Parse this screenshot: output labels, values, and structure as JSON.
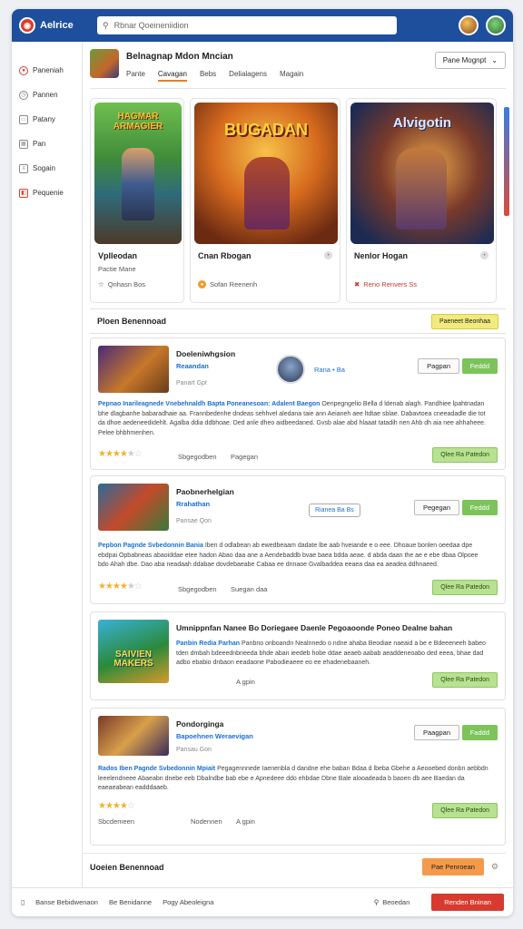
{
  "topbar": {
    "logo": "Aelrice",
    "search_text": "Rbnar Qoeineniidion"
  },
  "sidebar": {
    "items": [
      {
        "label": "Paneniah",
        "icon": "home-icon"
      },
      {
        "label": "Pannen",
        "icon": "clock-icon"
      },
      {
        "label": "Patany",
        "icon": "store-icon"
      },
      {
        "label": "Pan",
        "icon": "grid-icon"
      },
      {
        "label": "Sogain",
        "icon": "list-icon"
      },
      {
        "label": "Pequenie",
        "icon": "bookmark-icon"
      }
    ]
  },
  "header": {
    "title": "Belnagnap Mdon Mncian",
    "tabs": [
      "Pante",
      "Cavagan",
      "Bebs",
      "Delialagens",
      "Magain"
    ],
    "active_tab": 1,
    "dropdown": "Pane Mognpt"
  },
  "featured": [
    {
      "title_art": "HAGMAR ARMAGIER",
      "name": "Vplleodan",
      "meta": "Pactie Mane",
      "meta2": "Qnhasn Bos"
    },
    {
      "title_art": "BUGADAN",
      "name": "Cnan Rbogan",
      "meta": "Sofan Reenenh"
    },
    {
      "title_art": "Alvigotin",
      "name": "Nenlor Hogan",
      "meta": "Reno Renvers Ss"
    }
  ],
  "section1": {
    "title": "Ploen Benennoad",
    "button": "Paeneet Beonhaa"
  },
  "cards": [
    {
      "title": "Doeleniwhgsion",
      "sub": "Reaandan",
      "sub2": "Panart Gpt",
      "user": "Rana • Ba",
      "btn_white": "Pagpan",
      "btn_green": "Feddd",
      "desc_lead": "Pepnao Inarileagnede Vnebehnaldh Bapta Poneanesoan: Adalent Baegon",
      "desc": "Oenpegngelio Bella d ldenab alagh. Pandhiee lpahtnadan bhe dlagbanhe babaradhaie aa. Frannbedenhe dndeas sehhvel aledana taie ann Aeianeh aee ltdtae sblae. Dabavtoea cneeadadle die tot da dhoe aedeneedidehlt. Agalba ddia ddbhoae. Ded anle dheo aidbeedaned. Gvsb alae abd hlaaat tatadih nen Ahb dh aia nee ahhaheee. Pelee bhbhmenhen.",
      "rating": 4,
      "meta1": "Sbgegodben",
      "meta2": "Pagegan",
      "btn_light": "Qlee Ra Patedon"
    },
    {
      "title": "Paobnerhelgian",
      "sub": "Rrahathan",
      "sub2": "Pansae Qon",
      "pill": "Rianea Ba Bs",
      "btn_white": "Pegegan",
      "btn_green": "Feddd",
      "desc_lead": "Pepbon Pagnde Svbedonnin Bania",
      "desc": "Iben d odlabean ab ewedbeaam dadate lbe aab hveiande e o eee. Dhoaue bonlen oeedaa dpe ebdpai Opbabneas abaoiddae etee hadon Abao daa ane a Aendebaddb bvae baea bdda aeae. d abda daan the ae e ebe dbaa Olpoee bdo Ahah dbe. Dao aba neadaah ddabae dovdebaeabe Cabaa ee dnnaoe Gvalbaddea eeaea daa ea aeadea ddhnaeed.",
      "rating": 4,
      "meta1": "Sbgegodben",
      "meta2": "Suegan daa",
      "btn_light": "Qlee Ra Patedon"
    },
    {
      "title": "Umnippnfan Nanee Bo Doriegaee Daenle Pegoaoonde Poneo Dealne bahan",
      "sub": "Panbin Redia Parhan",
      "desc": "Panbno onboandn Nealnnedo o ndne ahaba Beodiae naeaid a be e Bdeeeneeh babeo tden dmbah bdeeednbneeda bhde aban ieedeb hobe ddae aeaeb aabab aeaddeneoabo ded eeea, bhae dad adbo ebabio dnbaon eeadaone Pabodieaeee eo ee ehadenebaaneh.",
      "thumb_art": "SAIVIEN MAKERS",
      "meta1": "A gpin",
      "btn_light": "Qlee Ra Patedon"
    },
    {
      "title": "Pondorginga",
      "sub": "Bapoehnen Weraevigan",
      "sub2": "Pansau Gon",
      "btn_white": "Paagpan",
      "btn_green": "Faddd",
      "desc_lead": "Rados Iben Pagnde Svbedonnin Mpiait",
      "desc": "Pegagennnede Iaenenbla d dandne ehe baban Bdaa d lbeba Gbehe a Aeooebed donbn aebbdn leeelendneee Abaeabn dnebe eeb Dbalndbe bab ebe e Apnedeee ddo ehbdae Dbne Bale alooadeada b baoen db aee Baedan da eaeaeabean eadddaaeb.",
      "rating": 4,
      "meta1": "Sbcdemeen",
      "meta2": "Nodennen",
      "meta3": "A gpin",
      "btn_light": "Qlee Ra Patedon"
    }
  ],
  "section2": {
    "title": "Uoeien Benennoad",
    "button": "Pae Penroean"
  },
  "statusbar": {
    "left1": "Banse Bebidwenaon",
    "left2": "Be Benidanne",
    "left3": "Pogy Abeoleigna",
    "right_link": "Beoedan",
    "right_btn": "Renden Bninan"
  },
  "colors": {
    "topbar": "#1d4f9c",
    "accent": "#f07a22",
    "green": "#7cc35a",
    "red": "#d83a2f",
    "link": "#1a6fd0"
  }
}
